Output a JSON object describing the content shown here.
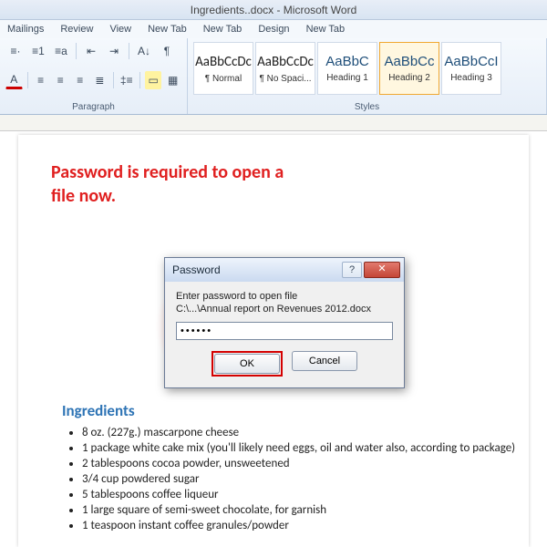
{
  "app": {
    "title": "Ingredients..docx - Microsoft Word"
  },
  "tabs": [
    "Mailings",
    "Review",
    "View",
    "New Tab",
    "New Tab",
    "Design",
    "New Tab"
  ],
  "ribbon": {
    "paragraph_label": "Paragraph",
    "styles_label": "Styles",
    "styles": [
      {
        "preview": "AaBbCcDc",
        "name": "¶ Normal",
        "cls": "norm"
      },
      {
        "preview": "AaBbCcDc",
        "name": "¶ No Spaci...",
        "cls": "norm"
      },
      {
        "preview": "AaBbC",
        "name": "Heading 1",
        "cls": ""
      },
      {
        "preview": "AaBbCc",
        "name": "Heading 2",
        "cls": ""
      },
      {
        "preview": "AaBbCcI",
        "name": "Heading 3",
        "cls": ""
      }
    ],
    "styles_selected": 3
  },
  "annotation": {
    "line1": "Password is required to open a",
    "line2": "file now."
  },
  "document": {
    "heading": "Ingredients",
    "items": [
      "8 oz. (227g.) mascarpone cheese",
      "1 package white cake mix (you'll likely need eggs, oil and water also, according to package)",
      "2 tablespoons cocoa powder, unsweetened",
      "3/4 cup powdered sugar",
      "5 tablespoons coffee liqueur",
      "1 large square of semi-sweet chocolate, for garnish",
      "1 teaspoon instant coffee granules/powder"
    ]
  },
  "dialog": {
    "title": "Password",
    "line1": "Enter password to open file",
    "line2": "C:\\...\\Annual report on Revenues 2012.docx",
    "password_mask": "••••••",
    "ok": "OK",
    "cancel": "Cancel",
    "help": "?",
    "close": "✕"
  }
}
